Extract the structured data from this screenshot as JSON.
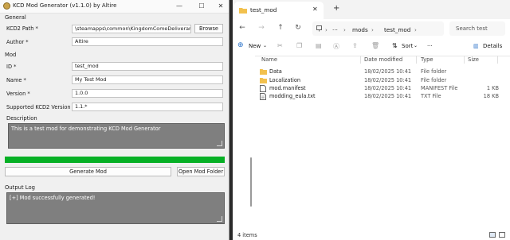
{
  "left_window": {
    "title": "KCD Mod Generator (v1.1.0) by Altire",
    "controls": {
      "minimize": "—",
      "maximize": "☐",
      "close": "✕"
    },
    "general_group": "General",
    "kcd2_path_label": "KCD2 Path *",
    "kcd2_path_value": "\\steamapps\\common\\KingdomComeDeliverance2",
    "browse_button": "Browse",
    "author_label": "Author *",
    "author_value": "Altire",
    "mod_group": "Mod",
    "id_label": "ID *",
    "id_value": "test_mod",
    "name_label": "Name *",
    "name_value": "My Test Mod",
    "version_label": "Version *",
    "version_value": "1.0.0",
    "supported_label": "Supported KCD2 Version",
    "supported_value": "1.1.*",
    "description_group": "Description",
    "description_value": "This is a test mod for demonstrating KCD Mod Generator",
    "progress": 1.0,
    "progress_color": "#06b025",
    "generate_button": "Generate Mod",
    "open_folder_button": "Open Mod Folder",
    "output_group": "Output Log",
    "output_text": "[+] Mod successfully generated!"
  },
  "explorer": {
    "tab_title": "test_mod",
    "tab_close": "✕",
    "new_tab": "+",
    "breadcrumb": {
      "parent": "mods",
      "current": "test_mod",
      "sep": "›",
      "more": "···"
    },
    "search_placeholder": "Search test",
    "commands": {
      "new": "New",
      "sort": "Sort",
      "more": "···",
      "details": "Details"
    },
    "columns": {
      "name": "Name",
      "date": "Date modified",
      "type": "Type",
      "size": "Size"
    },
    "files": [
      {
        "name": "Data",
        "date": "18/02/2025 10:41",
        "type": "File folder",
        "size": "",
        "icon": "folder-icon"
      },
      {
        "name": "Localization",
        "date": "18/02/2025 10:41",
        "type": "File folder",
        "size": "",
        "icon": "folder-icon"
      },
      {
        "name": "mod.manifest",
        "date": "18/02/2025 10:41",
        "type": "MANIFEST File",
        "size": "1 KB",
        "icon": "file-icon"
      },
      {
        "name": "modding_eula.txt",
        "date": "18/02/2025 10:41",
        "type": "TXT File",
        "size": "18 KB",
        "icon": "text-file-icon"
      }
    ],
    "status": "4 items"
  }
}
